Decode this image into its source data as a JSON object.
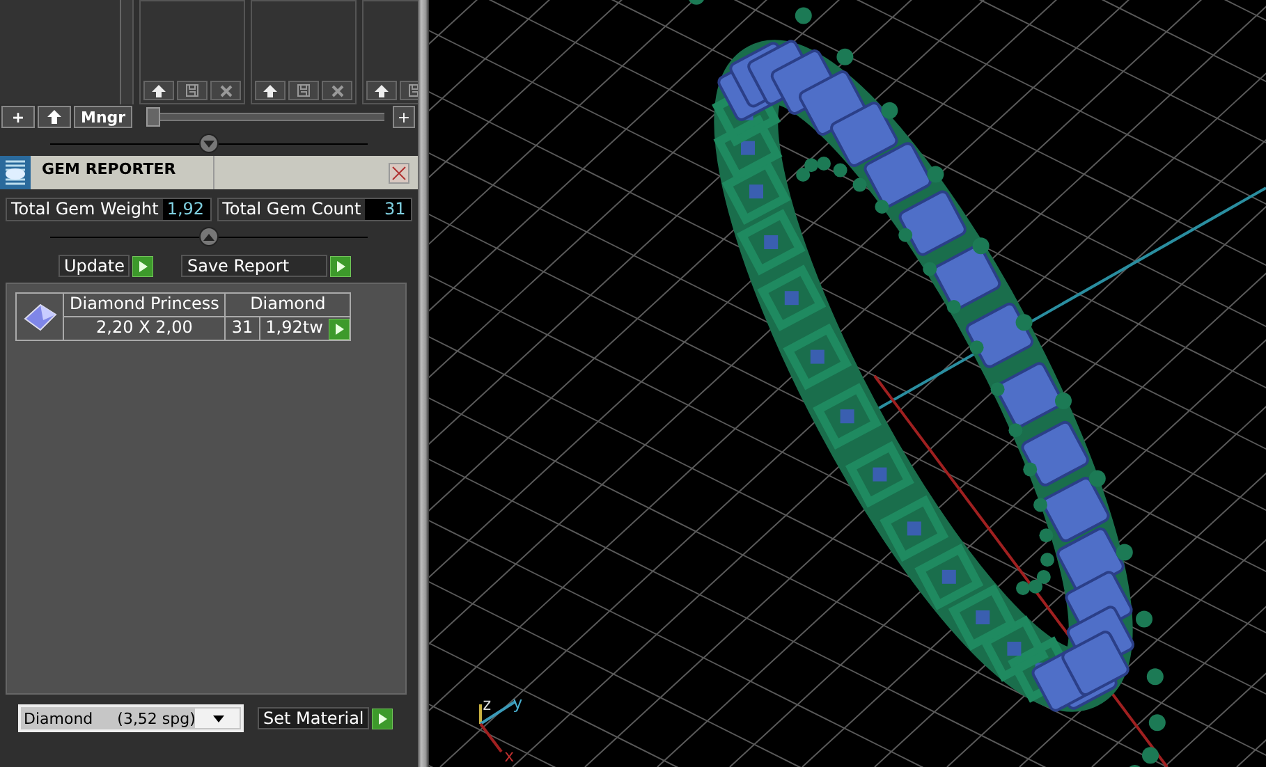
{
  "library_toolbar": {
    "add_label": "+",
    "manager_label": "Mngr",
    "zoom_add_label": "+",
    "thumb_slider": {
      "level": 0
    }
  },
  "gem_reporter": {
    "title": "GEM REPORTER",
    "totals": [
      {
        "label": "Total Gem Weight",
        "value": "1,92"
      },
      {
        "label": "Total Gem Count",
        "value": "31"
      }
    ],
    "actions": [
      "Update",
      "Save Report"
    ],
    "gems": [
      {
        "name": "Diamond Princess",
        "material": "Diamond",
        "size": "2,20 X 2,00",
        "count": "31",
        "weight": "1,92tw"
      }
    ],
    "material_select": {
      "value": "Diamond     (3,52 spg)"
    },
    "set_material": "Set Material"
  },
  "viewport": {
    "axis_labels": [
      "z",
      "y",
      "x"
    ]
  }
}
